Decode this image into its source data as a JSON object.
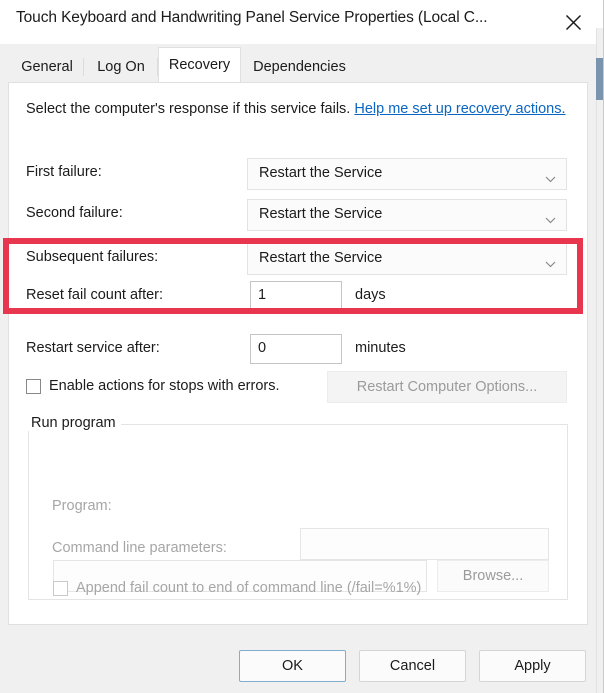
{
  "window": {
    "title": "Touch Keyboard and Handwriting Panel Service Properties (Local C...",
    "close_icon": "close-icon"
  },
  "tabs": [
    {
      "label": "General",
      "active": false
    },
    {
      "label": "Log On",
      "active": false
    },
    {
      "label": "Recovery",
      "active": true
    },
    {
      "label": "Dependencies",
      "active": false
    }
  ],
  "recovery": {
    "intro_text": "Select the computer's response if this service fails. ",
    "intro_link": "Help me set up recovery actions.",
    "first_failure": {
      "label": "First failure:",
      "value": "Restart the Service"
    },
    "second_failure": {
      "label": "Second failure:",
      "value": "Restart the Service"
    },
    "subsequent_failures": {
      "label": "Subsequent failures:",
      "value": "Restart the Service"
    },
    "reset_fail_count": {
      "label": "Reset fail count after:",
      "value": "1",
      "unit": "days"
    },
    "restart_service_after": {
      "label": "Restart service after:",
      "value": "0",
      "unit": "minutes"
    },
    "enable_actions_checkbox": {
      "label": "Enable actions for stops with errors.",
      "checked": false
    },
    "restart_computer_options_button": "Restart Computer Options...",
    "run_program": {
      "group_title": "Run program",
      "program_label": "Program:",
      "program_value": "",
      "browse_button": "Browse...",
      "command_line_label": "Command line parameters:",
      "command_line_value": "",
      "append_fail_count_checkbox": {
        "label": "Append fail count to end of command line (/fail=%1%)",
        "checked": false
      }
    }
  },
  "footer": {
    "ok": "OK",
    "cancel": "Cancel",
    "apply": "Apply"
  },
  "colors": {
    "highlight": "#e8364f",
    "link": "#0a66c2",
    "scrollbar_thumb": "#7b94ad"
  }
}
